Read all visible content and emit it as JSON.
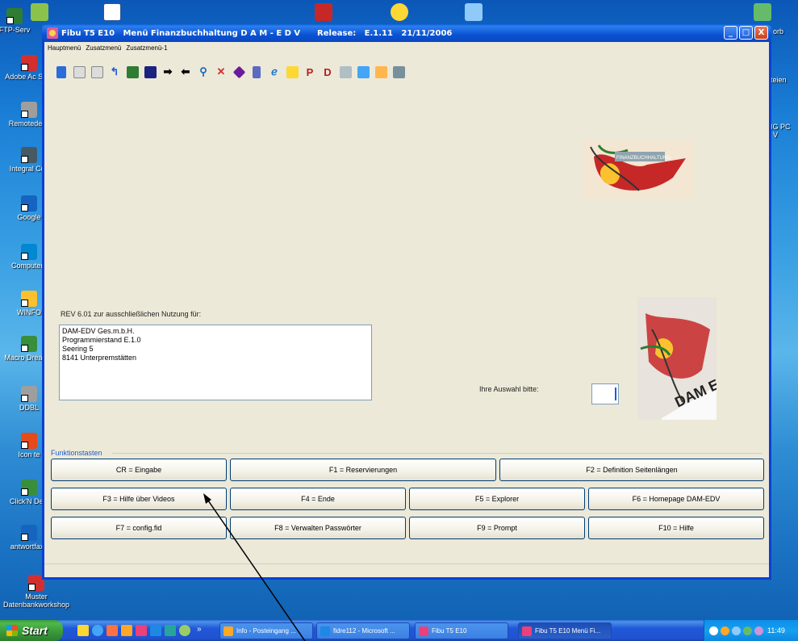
{
  "desktop": {
    "icons": [
      {
        "label": "FTP-Serv"
      },
      {
        "label": "Adobe Ac Stan"
      },
      {
        "label": "Remotedesk"
      },
      {
        "label": "Integral Cus"
      },
      {
        "label": "Google"
      },
      {
        "label": "Computerv"
      },
      {
        "label": "WINFO"
      },
      {
        "label": "Macro Dreamw"
      },
      {
        "label": "DDBL"
      },
      {
        "label": "Icon te"
      },
      {
        "label": "Click'N Desi"
      },
      {
        "label": "antwortfax_"
      },
      {
        "label": "Muster Datenbankworkshop"
      }
    ],
    "right_labels": [
      "orb",
      "teien",
      "IG PC",
      "V"
    ]
  },
  "window": {
    "title": "Fibu T5 E10   Menü Finanzbuchhaltung D A M - E D V      Release:   E.1.11   21/11/2006",
    "menu": [
      "Hauptmenü",
      "Zusatzmenü",
      "Zusatzmenü-1"
    ],
    "controls": {
      "minimize": "_",
      "maximize": "□",
      "close": "X"
    },
    "logo_text": "FINANZBUCHHALTUNG",
    "logo2_text": "DAM EDV",
    "rev_label": "REV 6.01 zur ausschließlichen Nutzung für:",
    "address_lines": [
      "DAM-EDV Ges.m.b.H.",
      "Programmierstand E.1.0",
      "Seering 5",
      "8141 Unterpremstätten"
    ],
    "choice_label": "Ihre Auswahl bitte:",
    "choice_value": "",
    "function_keys_label": "Funktionstasten",
    "buttons": [
      "CR = Eingabe",
      "F1 = Reservierungen",
      "F2 = Definition Seitenlängen",
      "F3 = Hilfe über Videos",
      "F4 = Ende",
      "F5 = Explorer",
      "F6 = Homepage DAM-EDV",
      "F7 = config.fid",
      "F8 = Verwalten Passwörter",
      "F9 = Prompt",
      "F10 = Hilfe"
    ]
  },
  "taskbar": {
    "start": "Start",
    "tasks": [
      "Info - Posteingang ...",
      "fidre112 - Microsoft ...",
      "Fibu T5 E10",
      "Fibu T5 E10  Menü Fi..."
    ],
    "clock": "11:49"
  }
}
